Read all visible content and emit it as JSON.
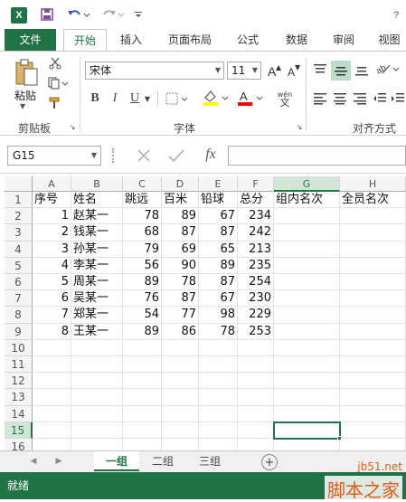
{
  "app": {
    "logo_letter": "X"
  },
  "qat": {
    "save_icon": "save-icon",
    "undo_icon": "undo-icon",
    "redo_icon": "redo-icon"
  },
  "tabs": {
    "file": "文件",
    "items": [
      "开始",
      "插入",
      "页面布局",
      "公式",
      "数据",
      "审阅",
      "视图"
    ],
    "active": "开始"
  },
  "ribbon": {
    "clipboard": {
      "paste": "粘贴",
      "label": "剪贴板"
    },
    "font": {
      "name": "宋体",
      "size": "11",
      "bold": "B",
      "italic": "I",
      "underline": "U",
      "label": "字体",
      "wen": "wén",
      "wen_char": "文"
    },
    "align": {
      "label": "对齐方式"
    }
  },
  "formula_bar": {
    "name_box": "G15",
    "fx": "fx",
    "value": ""
  },
  "sheet": {
    "columns": [
      "A",
      "B",
      "C",
      "D",
      "E",
      "F",
      "G",
      "H"
    ],
    "rows": [
      "1",
      "2",
      "3",
      "4",
      "5",
      "6",
      "7",
      "8",
      "9",
      "10",
      "11",
      "12",
      "13",
      "14",
      "15",
      "16"
    ],
    "header": [
      "序号",
      "姓名",
      "跳远",
      "百米",
      "铅球",
      "总分",
      "组内名次",
      "全员名次"
    ],
    "data": [
      [
        "1",
        "赵某一",
        "78",
        "89",
        "67",
        "234"
      ],
      [
        "2",
        "钱某一",
        "68",
        "87",
        "87",
        "242"
      ],
      [
        "3",
        "孙某一",
        "79",
        "69",
        "65",
        "213"
      ],
      [
        "4",
        "李某一",
        "56",
        "90",
        "89",
        "235"
      ],
      [
        "5",
        "周某一",
        "89",
        "78",
        "87",
        "254"
      ],
      [
        "6",
        "吴某一",
        "76",
        "87",
        "67",
        "230"
      ],
      [
        "7",
        "郑某一",
        "54",
        "77",
        "98",
        "229"
      ],
      [
        "8",
        "王某一",
        "89",
        "86",
        "78",
        "253"
      ]
    ],
    "selected_cell": "G15"
  },
  "sheet_tabs": {
    "items": [
      "一组",
      "二组",
      "三组"
    ],
    "active": "一组",
    "add": "+"
  },
  "status": {
    "text": "就绪"
  },
  "watermark": {
    "url": "jb51.net",
    "brand": "脚本之家"
  },
  "colors": {
    "accent": "#217346",
    "font_color": "#ff0000",
    "highlight": "#ffff00"
  }
}
